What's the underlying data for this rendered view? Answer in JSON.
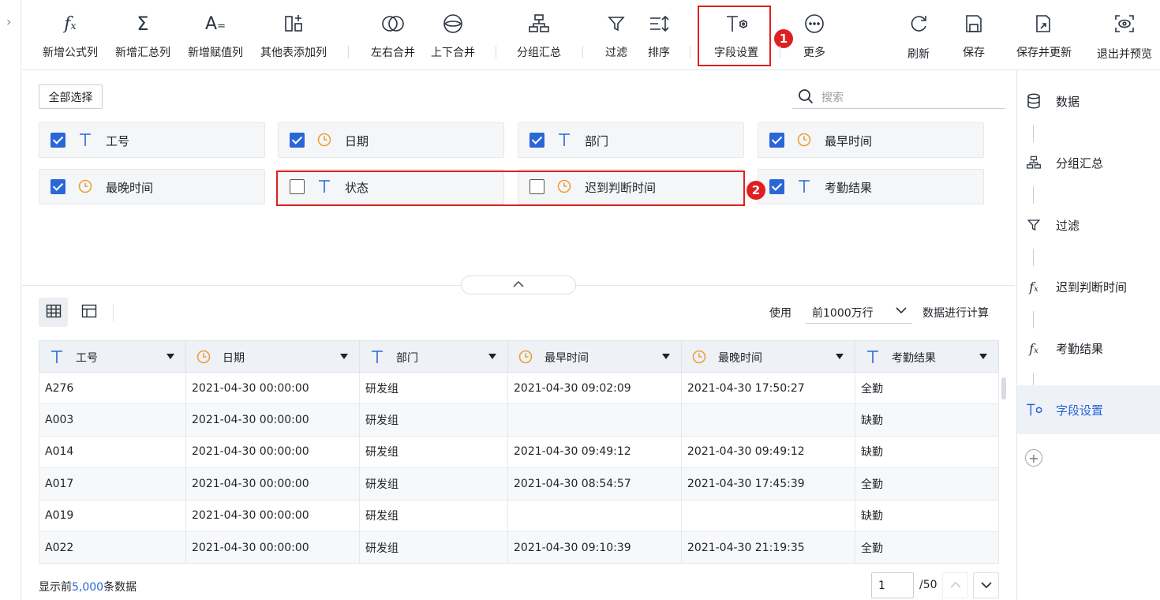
{
  "toolbar": {
    "items": [
      {
        "label": "新增公式列",
        "icon": "formula-icon"
      },
      {
        "label": "新增汇总列",
        "icon": "sigma-icon"
      },
      {
        "label": "新增赋值列",
        "icon": "assign-icon"
      },
      {
        "label": "其他表添加列",
        "icon": "add-column-icon"
      },
      {
        "label": "左右合并",
        "icon": "merge-horizontal-icon"
      },
      {
        "label": "上下合并",
        "icon": "merge-vertical-icon"
      },
      {
        "label": "分组汇总",
        "icon": "group-icon"
      },
      {
        "label": "过滤",
        "icon": "filter-icon"
      },
      {
        "label": "排序",
        "icon": "sort-icon"
      },
      {
        "label": "字段设置",
        "icon": "field-settings-icon"
      },
      {
        "label": "更多",
        "icon": "more-icon"
      },
      {
        "label": "刷新",
        "icon": "refresh-icon"
      },
      {
        "label": "保存",
        "icon": "save-icon"
      },
      {
        "label": "保存并更新",
        "icon": "save-update-icon"
      },
      {
        "label": "退出并预览",
        "icon": "exit-preview-icon"
      }
    ],
    "badge1": "1"
  },
  "fields": {
    "select_all": "全部选择",
    "search_placeholder": "搜索",
    "badge2": "2",
    "items": [
      {
        "name": "工号",
        "type": "text",
        "checked": true
      },
      {
        "name": "日期",
        "type": "date",
        "checked": true
      },
      {
        "name": "部门",
        "type": "text",
        "checked": true
      },
      {
        "name": "最早时间",
        "type": "date",
        "checked": true
      },
      {
        "name": "最晚时间",
        "type": "date",
        "checked": true
      },
      {
        "name": "状态",
        "type": "text",
        "checked": false
      },
      {
        "name": "迟到判断时间",
        "type": "date",
        "checked": false
      },
      {
        "name": "考勤结果",
        "type": "text",
        "checked": true
      }
    ]
  },
  "table": {
    "use_label": "使用",
    "row_limit": "前1000万行",
    "calc_label": "数据进行计算",
    "columns": [
      {
        "name": "工号",
        "type": "text"
      },
      {
        "name": "日期",
        "type": "date"
      },
      {
        "name": "部门",
        "type": "text"
      },
      {
        "name": "最早时间",
        "type": "date"
      },
      {
        "name": "最晚时间",
        "type": "date"
      },
      {
        "name": "考勤结果",
        "type": "text"
      }
    ],
    "rows": [
      [
        "A276",
        "2021-04-30 00:00:00",
        "研发组",
        "2021-04-30 09:02:09",
        "2021-04-30 17:50:27",
        "全勤"
      ],
      [
        "A003",
        "2021-04-30 00:00:00",
        "研发组",
        "",
        "",
        "缺勤"
      ],
      [
        "A014",
        "2021-04-30 00:00:00",
        "研发组",
        "2021-04-30 09:49:12",
        "2021-04-30 09:49:12",
        "缺勤"
      ],
      [
        "A017",
        "2021-04-30 00:00:00",
        "研发组",
        "2021-04-30 08:54:57",
        "2021-04-30 17:45:39",
        "全勤"
      ],
      [
        "A019",
        "2021-04-30 00:00:00",
        "研发组",
        "",
        "",
        "缺勤"
      ],
      [
        "A022",
        "2021-04-30 00:00:00",
        "研发组",
        "2021-04-30 09:10:39",
        "2021-04-30 21:19:35",
        "全勤"
      ]
    ]
  },
  "footer": {
    "prefix": "显示前",
    "count": "5,000",
    "suffix": "条数据",
    "page": "1",
    "total": "/50"
  },
  "steps": [
    {
      "label": "数据",
      "icon": "database-icon",
      "active": false
    },
    {
      "label": "分组汇总",
      "icon": "group-icon",
      "active": false
    },
    {
      "label": "过滤",
      "icon": "filter-icon",
      "active": false
    },
    {
      "label": "迟到判断时间",
      "icon": "formula-icon",
      "active": false
    },
    {
      "label": "考勤结果",
      "icon": "formula-icon",
      "active": false
    },
    {
      "label": "字段设置",
      "icon": "field-settings-icon",
      "active": true
    }
  ],
  "colors": {
    "accent": "#2b66d9",
    "highlight": "#e02020",
    "date_icon": "#e8a23a"
  }
}
